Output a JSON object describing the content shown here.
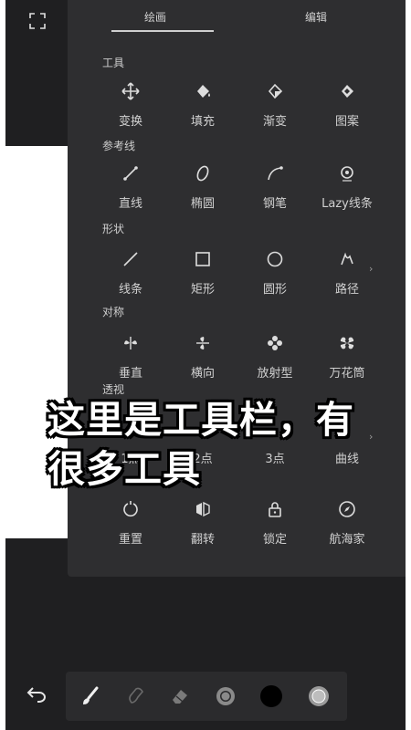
{
  "tabs": {
    "draw": "绘画",
    "edit": "编辑"
  },
  "sections": {
    "tools": "工具",
    "guides": "参考线",
    "shapes": "形状",
    "symmetry": "对称",
    "perspective": "透视"
  },
  "tools": [
    {
      "label": "变换",
      "icon": "move-icon"
    },
    {
      "label": "填充",
      "icon": "fill-bucket-icon"
    },
    {
      "label": "渐变",
      "icon": "gradient-bucket-icon"
    },
    {
      "label": "图案",
      "icon": "pattern-bucket-icon"
    }
  ],
  "guides": [
    {
      "label": "直线",
      "icon": "line-guide-icon"
    },
    {
      "label": "椭圆",
      "icon": "ellipse-guide-icon"
    },
    {
      "label": "钢笔",
      "icon": "pen-guide-icon"
    },
    {
      "label": "Lazy线条",
      "icon": "lazy-line-icon"
    }
  ],
  "shapes": [
    {
      "label": "线条",
      "icon": "line-icon"
    },
    {
      "label": "矩形",
      "icon": "rectangle-icon"
    },
    {
      "label": "圆形",
      "icon": "circle-icon"
    },
    {
      "label": "路径",
      "icon": "path-icon"
    }
  ],
  "symmetry": [
    {
      "label": "垂直",
      "icon": "vertical-symmetry-icon"
    },
    {
      "label": "横向",
      "icon": "horizontal-symmetry-icon"
    },
    {
      "label": "放射型",
      "icon": "radial-symmetry-icon"
    },
    {
      "label": "万花筒",
      "icon": "kaleidoscope-icon"
    }
  ],
  "perspective": [
    {
      "label": "1点",
      "icon": "one-point-icon"
    },
    {
      "label": "2点",
      "icon": "two-point-icon"
    },
    {
      "label": "3点",
      "icon": "three-point-icon"
    },
    {
      "label": "曲线",
      "icon": "curve-icon"
    }
  ],
  "actions": [
    {
      "label": "重置",
      "icon": "reset-icon"
    },
    {
      "label": "翻转",
      "icon": "flip-icon"
    },
    {
      "label": "锁定",
      "icon": "lock-icon"
    },
    {
      "label": "航海家",
      "icon": "compass-icon"
    }
  ],
  "caption": {
    "line1": "这里是工具栏，有",
    "line2": "很多工具"
  },
  "bottom_bar": [
    "undo-icon",
    "brush-icon",
    "smudge-icon",
    "eraser-icon",
    "brush-size-icon",
    "color-swatch-icon",
    "opacity-icon"
  ],
  "colors": {
    "panel": "#2e2e30",
    "background": "#1f1f21",
    "current_color": "#000000"
  }
}
